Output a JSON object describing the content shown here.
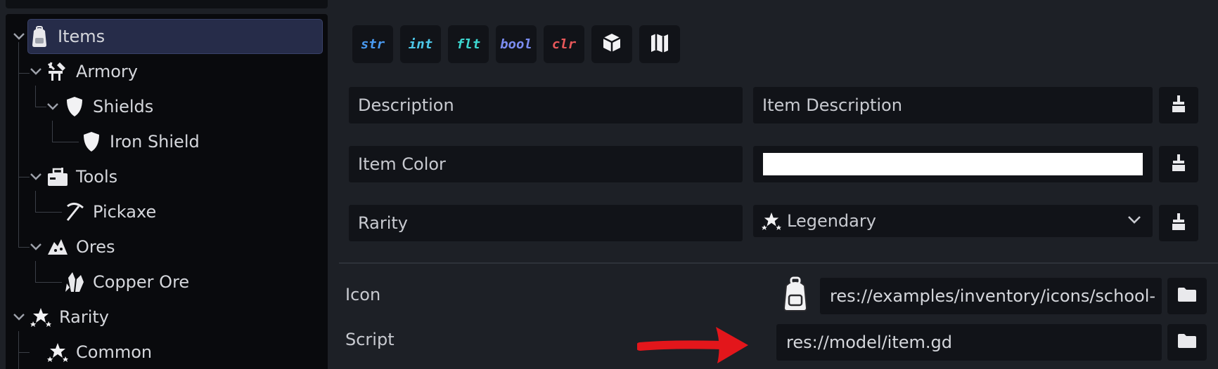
{
  "tree": {
    "items": [
      {
        "label": "Items",
        "icon": "backpack-icon",
        "selected": true
      },
      {
        "label": "Armory",
        "icon": "armory-icon"
      },
      {
        "label": "Shields",
        "icon": "shield-icon"
      },
      {
        "label": "Iron Shield",
        "icon": "shield-icon"
      },
      {
        "label": "Tools",
        "icon": "toolbox-icon"
      },
      {
        "label": "Pickaxe",
        "icon": "pickaxe-icon"
      },
      {
        "label": "Ores",
        "icon": "ore-pile-icon"
      },
      {
        "label": "Copper Ore",
        "icon": "crystal-icon"
      },
      {
        "label": "Rarity",
        "icon": "stars-icon"
      },
      {
        "label": "Common",
        "icon": "stars-icon"
      }
    ]
  },
  "toolbar": {
    "types": [
      {
        "label": "str",
        "color": "#4a9bf2"
      },
      {
        "label": "int",
        "color": "#4dc7e8"
      },
      {
        "label": "flt",
        "color": "#3dd7d0"
      },
      {
        "label": "bool",
        "color": "#7b8cf0"
      },
      {
        "label": "clr",
        "color": "#e8585a"
      }
    ],
    "resource_icon": "cube-icon",
    "map_icon": "map-icon"
  },
  "properties": {
    "description": {
      "name": "Description",
      "value": "Item Description"
    },
    "item_color": {
      "name": "Item Color",
      "value_color": "#ffffff"
    },
    "rarity": {
      "name": "Rarity",
      "value": "Legendary"
    }
  },
  "resources": {
    "icon": {
      "label": "Icon",
      "path": "res://examples/inventory/icons/school-"
    },
    "script": {
      "label": "Script",
      "path": "res://model/item.gd"
    }
  },
  "annotation_arrow_color": "#e3161b"
}
